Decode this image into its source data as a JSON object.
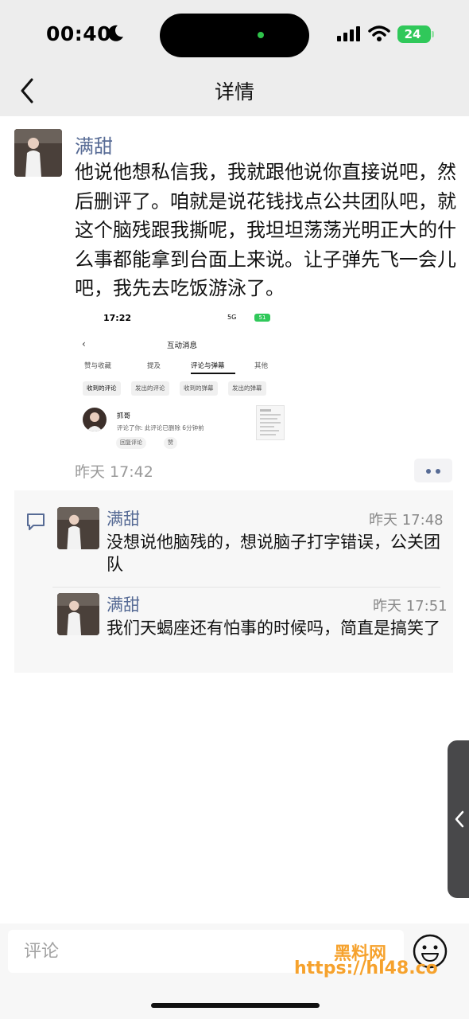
{
  "status_bar": {
    "time": "00:40",
    "battery": "24"
  },
  "header": {
    "title": "详情"
  },
  "post": {
    "author": "满甜",
    "text": "他说他想私信我，我就跟他说你直接说吧，然后删评了。咱就是说花钱找点公共团队吧，就这个脑残跟我撕呢，我坦坦荡荡光明正大的什么事都能拿到台面上来说。让子弹先飞一会儿吧，我先去吃饭游泳了。",
    "time": "昨天 17:42",
    "screenshot": {
      "time": "17:22",
      "network": "5G",
      "battery": "51",
      "title": "互动消息",
      "tabs": [
        "赞与收藏",
        "提及",
        "评论与弹幕",
        "其他"
      ],
      "subtabs": [
        "收到的评论",
        "发出的评论",
        "收到的弹幕",
        "发出的弹幕"
      ],
      "item": {
        "name": "抓哥",
        "desc": "评论了你: 此评论已删除  6分钟前",
        "reply": "回复评论",
        "like": "赞"
      }
    }
  },
  "comments": [
    {
      "author": "满甜",
      "time": "昨天 17:48",
      "text": "没想说他脑残的，想说脑子打字错误，公关团队"
    },
    {
      "author": "满甜",
      "time": "昨天 17:51",
      "text": "我们天蝎座还有怕事的时候吗，简直是搞笑了"
    }
  ],
  "comment_input": {
    "placeholder": "评论"
  },
  "watermark": {
    "line1": "黑料网",
    "line2": "https://hl48.co"
  },
  "icons": [
    "moon-icon",
    "signal-icon",
    "wifi-icon",
    "back-chevron-icon",
    "comment-bubble-icon",
    "more-dots-icon",
    "chevron-left-icon",
    "emoji-icon"
  ],
  "colors": {
    "name_link": "#576b95",
    "battery": "#30c85a",
    "watermark": "#f6a22d"
  }
}
